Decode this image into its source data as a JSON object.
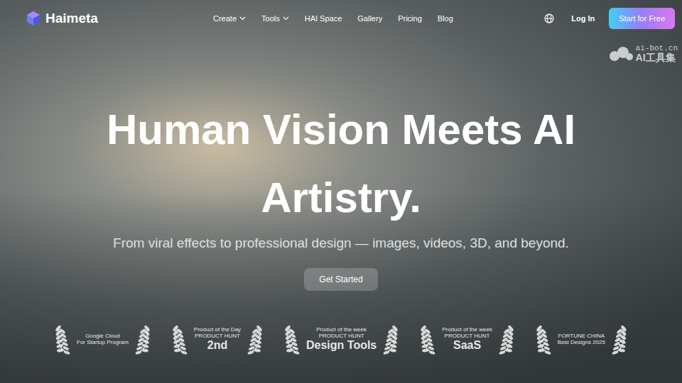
{
  "nav": {
    "logo": "Haimeta",
    "items": [
      {
        "label": "Create",
        "dropdown": true
      },
      {
        "label": "Tools",
        "dropdown": true
      },
      {
        "label": "HAI Space",
        "dropdown": false
      },
      {
        "label": "Gallery",
        "dropdown": false
      },
      {
        "label": "Pricing",
        "dropdown": false
      },
      {
        "label": "Blog",
        "dropdown": false
      }
    ],
    "login": "Log In",
    "cta": "Start for Free"
  },
  "watermark": {
    "domain": "ai-bot.cn",
    "name": "AI工具集"
  },
  "hero": {
    "title_lines": [
      "Human Vision Meets AI",
      "Artistry."
    ],
    "subtitle": "From viral effects to professional design — images, videos, 3D, and beyond.",
    "button": "Get Started"
  },
  "badges": [
    {
      "lines": [
        {
          "text": "Google Cloud",
          "kind": "small"
        },
        {
          "text": "For Startup Program",
          "kind": "small"
        }
      ]
    },
    {
      "lines": [
        {
          "text": "Product of the Day",
          "kind": "small"
        },
        {
          "text": "PRODUCT HUNT",
          "kind": "small"
        },
        {
          "text": "2nd",
          "kind": "big"
        }
      ]
    },
    {
      "lines": [
        {
          "text": "Product of the week",
          "kind": "small"
        },
        {
          "text": "PRODUCT HUNT",
          "kind": "small"
        },
        {
          "text": "Design Tools",
          "kind": "big"
        }
      ]
    },
    {
      "lines": [
        {
          "text": "Product of the week",
          "kind": "small"
        },
        {
          "text": "PRODUCT HUNT",
          "kind": "small"
        },
        {
          "text": "SaaS",
          "kind": "big"
        }
      ]
    },
    {
      "lines": [
        {
          "text": "FORTUNE CHINA",
          "kind": "small"
        },
        {
          "text": "Best Designs 2025",
          "kind": "small"
        }
      ]
    }
  ]
}
